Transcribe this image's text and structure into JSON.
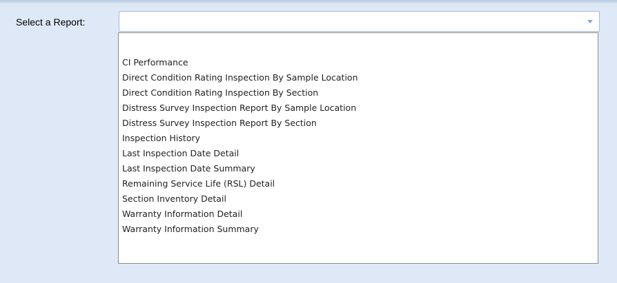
{
  "form": {
    "label": "Select a Report:",
    "selected_value": "",
    "dropdown_icon": "chevron-down-icon"
  },
  "report_options": [
    "CI Performance",
    "Direct Condition Rating Inspection By Sample Location",
    "Direct Condition Rating Inspection By Section",
    "Distress Survey Inspection Report By Sample Location",
    "Distress Survey Inspection Report By Section",
    "Inspection History",
    "Last Inspection Date Detail",
    "Last Inspection Date Summary",
    "Remaining Service Life (RSL) Detail",
    "Section Inventory Detail",
    "Warranty Information Detail",
    "Warranty Information Summary"
  ],
  "colors": {
    "page_background": "#dfe8f6",
    "field_border": "#a5bcd8",
    "list_border": "#8c8c8c",
    "arrow": "#8aa6c8"
  }
}
